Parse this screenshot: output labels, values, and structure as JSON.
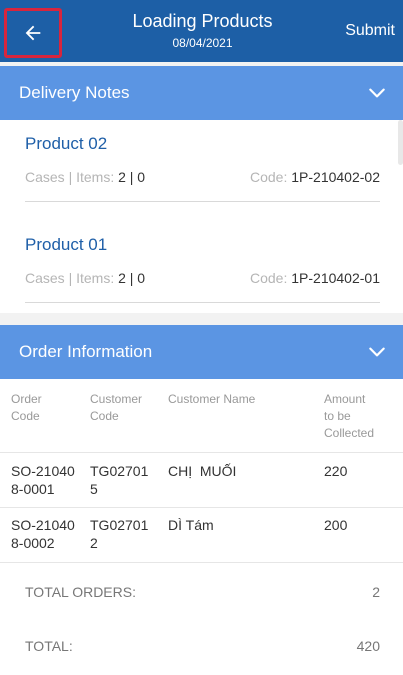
{
  "header": {
    "title": "Loading Products",
    "date": "08/04/2021",
    "submit_label": "Submit"
  },
  "delivery_notes": {
    "title": "Delivery Notes",
    "products": [
      {
        "name": "Product 02",
        "meta_label": "Cases | Items:",
        "meta_value": "2 | 0",
        "code_label": "Code:",
        "code_value": "1P-210402-02"
      },
      {
        "name": "Product 01",
        "meta_label": "Cases | Items:",
        "meta_value": "2 | 0",
        "code_label": "Code:",
        "code_value": "1P-210402-01"
      }
    ]
  },
  "order_information": {
    "title": "Order Information",
    "columns": {
      "order_code": "Order\nCode",
      "customer_code": "Customer\nCode",
      "customer_name": "Customer Name",
      "amount": "Amount\nto be\nCollected"
    },
    "rows": [
      {
        "order_code": "SO-21040\n8-0001",
        "customer_code": "TG02701\n5",
        "customer_name": "CHỊ  MUỐI",
        "amount": "220"
      },
      {
        "order_code": "SO-21040\n8-0002",
        "customer_code": "TG02701\n2",
        "customer_name": "DÌ Tám",
        "amount": "200"
      }
    ],
    "total_orders_label": "TOTAL ORDERS:",
    "total_orders_value": "2",
    "total_label": "TOTAL:",
    "total_value": "420"
  },
  "colors": {
    "header": "#1d5fa6",
    "section_bar": "#5b95e3",
    "product_name": "#1f5fa8",
    "highlight_border": "#d8253d"
  },
  "icons": {
    "back": "arrow-left-icon",
    "collapse": "chevron-down-icon"
  }
}
